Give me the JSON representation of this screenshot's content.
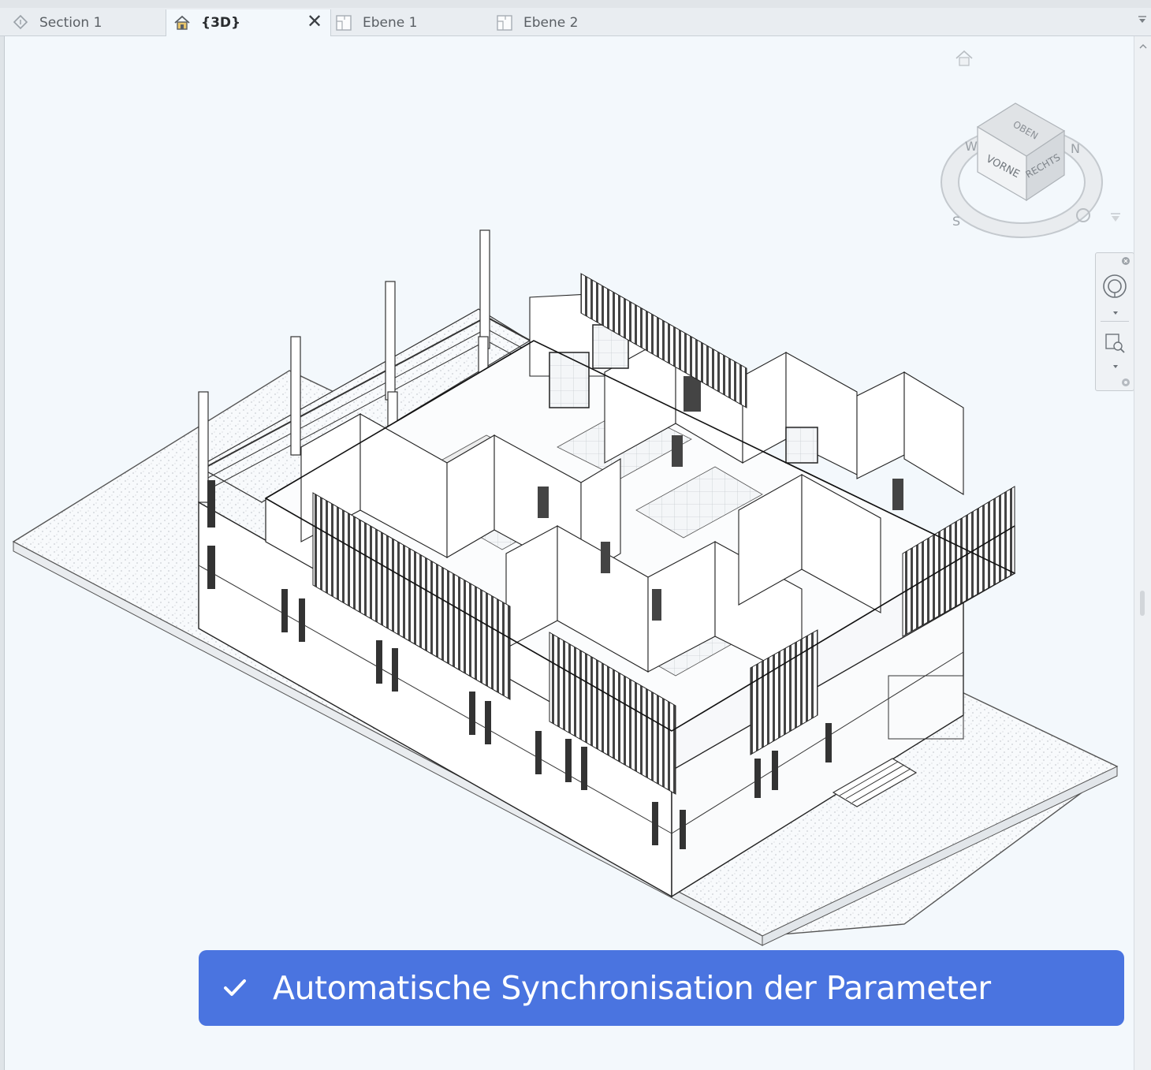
{
  "tabs": [
    {
      "label": "Section 1",
      "icon": "section-icon",
      "active": false
    },
    {
      "label": "{3D}",
      "icon": "home-icon",
      "active": true
    },
    {
      "label": "Ebene 1",
      "icon": "floorplan-icon",
      "active": false
    },
    {
      "label": "Ebene 2",
      "icon": "floorplan-icon",
      "active": false
    }
  ],
  "tab_close_glyph": "✕",
  "viewcube": {
    "faces": {
      "top": "OBEN",
      "front": "VORNE",
      "right": "RECHTS"
    },
    "compass": {
      "west": "W",
      "south": "S",
      "north": "N"
    }
  },
  "banner": {
    "message": "Automatische Synchronisation der Parameter",
    "icon": "check-icon",
    "color": "#4a74e0"
  },
  "colors": {
    "background": "#f3f8fc",
    "tabbar": "#e9edf1",
    "lines": "#2b2b2b"
  }
}
